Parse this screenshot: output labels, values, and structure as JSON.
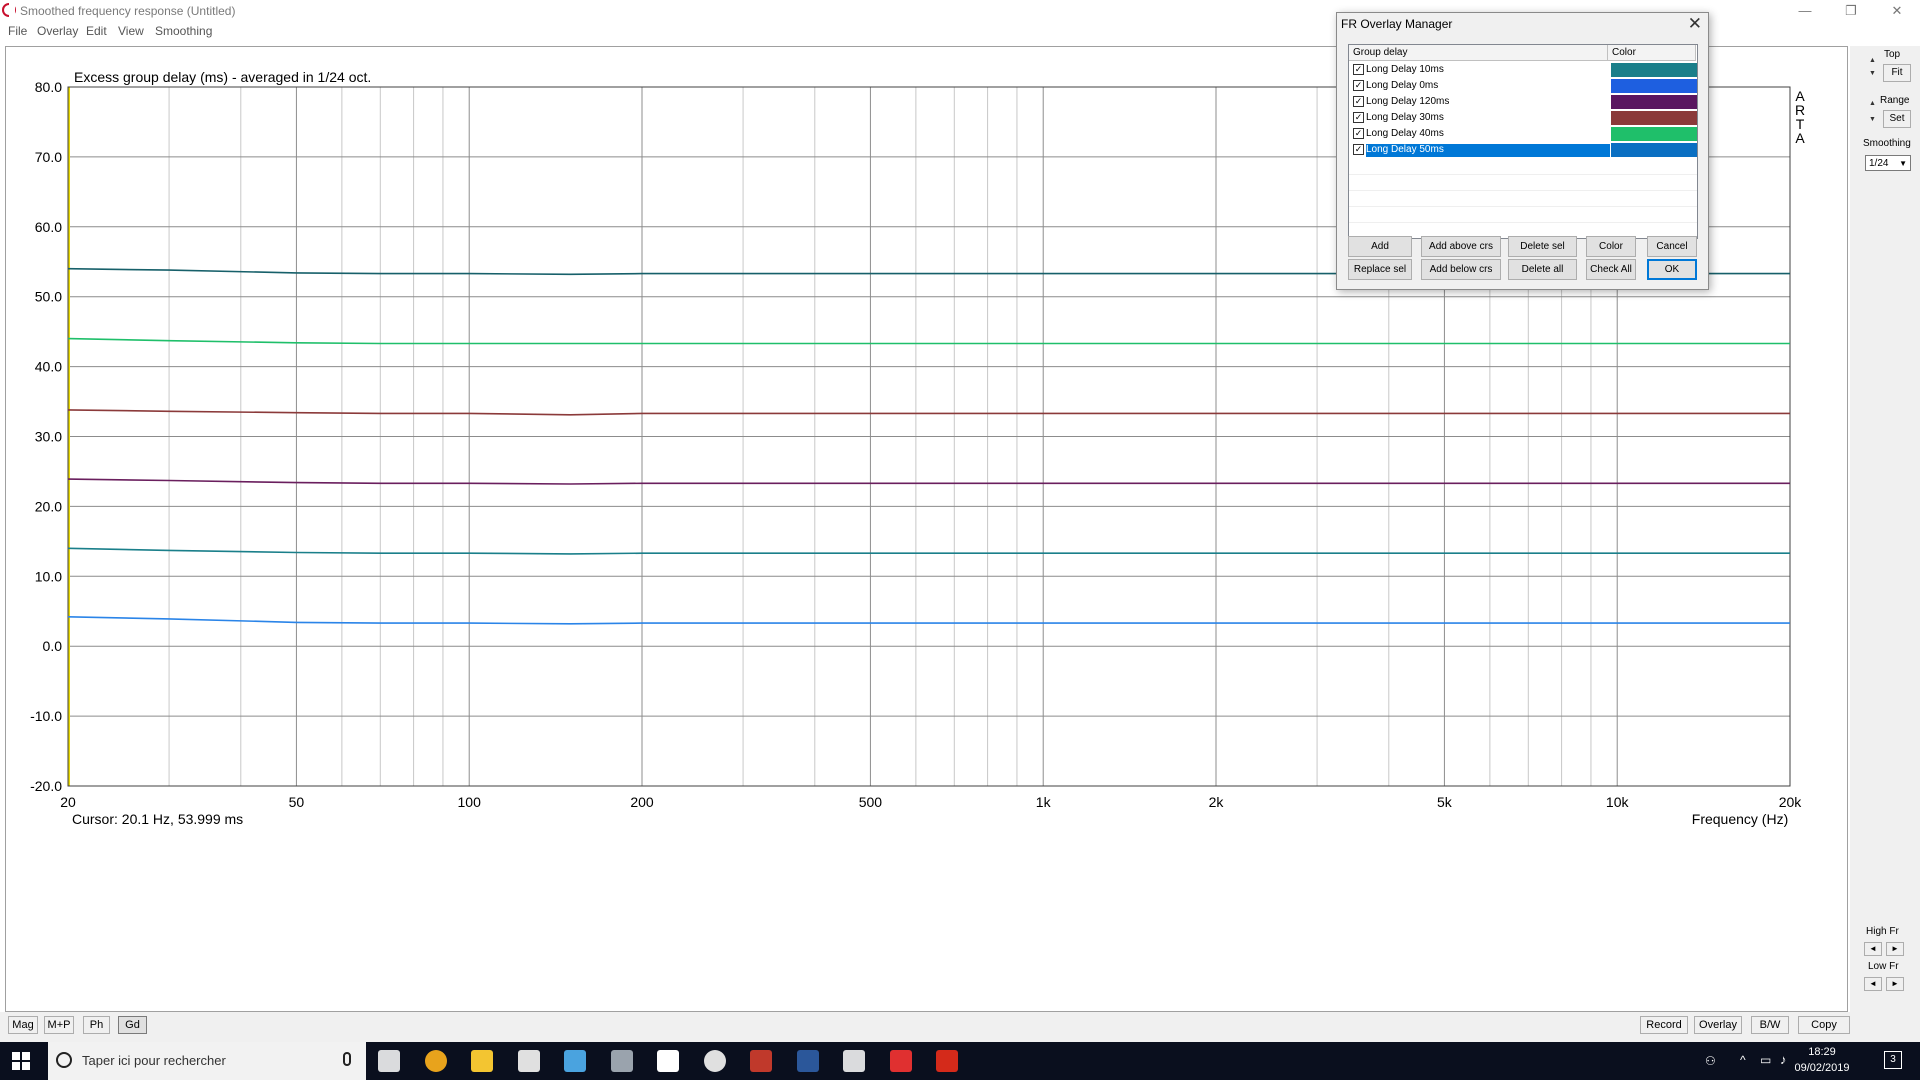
{
  "window": {
    "title": "Smoothed frequency response (Untitled)",
    "controls": [
      "—",
      "❐",
      "✕"
    ]
  },
  "menu": [
    "File",
    "Overlay",
    "Edit",
    "View",
    "Smoothing"
  ],
  "plot": {
    "caption": "Excess group delay (ms) - averaged in 1/24 oct.",
    "brand_letters": [
      "A",
      "R",
      "T",
      "A"
    ],
    "cursor": "Cursor: 20.1 Hz, 53.999 ms",
    "x_axis_label": "Frequency (Hz)"
  },
  "chart_data": {
    "type": "line",
    "title": "Excess group delay (ms) - averaged in 1/24 oct.",
    "xlabel": "Frequency (Hz)",
    "ylabel": "",
    "xscale": "log",
    "xlim": [
      20,
      20000
    ],
    "ylim": [
      -20,
      80
    ],
    "grid": true,
    "y_ticks": [
      "80.0",
      "70.0",
      "60.0",
      "50.0",
      "40.0",
      "30.0",
      "20.0",
      "10.0",
      "0.0",
      "-10.0",
      "-20.0"
    ],
    "y_tick_values": [
      80,
      70,
      60,
      50,
      40,
      30,
      20,
      10,
      0,
      -10,
      -20
    ],
    "x_ticks": [
      {
        "value": 20,
        "label": "20"
      },
      {
        "value": 50,
        "label": "50"
      },
      {
        "value": 100,
        "label": "100"
      },
      {
        "value": 200,
        "label": "200"
      },
      {
        "value": 500,
        "label": "500"
      },
      {
        "value": 1000,
        "label": "1k"
      },
      {
        "value": 2000,
        "label": "2k"
      },
      {
        "value": 5000,
        "label": "5k"
      },
      {
        "value": 10000,
        "label": "10k"
      },
      {
        "value": 20000,
        "label": "20k"
      }
    ],
    "x": [
      20,
      30,
      50,
      70,
      100,
      150,
      200,
      500,
      1000,
      5000,
      20000
    ],
    "series": [
      {
        "name": "Long Delay 10ms",
        "color": "#1a7f8a",
        "values": [
          14.0,
          13.7,
          13.4,
          13.3,
          13.3,
          13.2,
          13.3,
          13.3,
          13.3,
          13.3,
          13.3
        ]
      },
      {
        "name": "Long Delay 0ms",
        "color": "#2a84e8",
        "values": [
          4.2,
          3.9,
          3.4,
          3.3,
          3.3,
          3.2,
          3.3,
          3.3,
          3.3,
          3.3,
          3.3
        ]
      },
      {
        "name": "Long Delay 120ms",
        "color": "#6a1f5e",
        "values": [
          23.9,
          23.7,
          23.4,
          23.3,
          23.3,
          23.2,
          23.3,
          23.3,
          23.3,
          23.3,
          23.3
        ]
      },
      {
        "name": "Long Delay 30ms",
        "color": "#8b3a3a",
        "values": [
          33.8,
          33.6,
          33.4,
          33.3,
          33.3,
          33.1,
          33.3,
          33.3,
          33.3,
          33.3,
          33.3
        ]
      },
      {
        "name": "Long Delay 40ms",
        "color": "#1fbf6a",
        "values": [
          44.0,
          43.7,
          43.4,
          43.3,
          43.3,
          43.3,
          43.3,
          43.3,
          43.3,
          43.3,
          43.3
        ]
      },
      {
        "name": "Long Delay 50ms",
        "color": "#17606a",
        "values": [
          54.0,
          53.8,
          53.4,
          53.3,
          53.3,
          53.2,
          53.3,
          53.3,
          53.3,
          53.3,
          53.3
        ]
      }
    ]
  },
  "right_panel": {
    "top_label": "Top",
    "fit_label": "Fit",
    "range_label": "Range",
    "set_label": "Set",
    "smoothing_label": "Smoothing",
    "smoothing_value": "1/24",
    "high_fr_label": "High Fr",
    "low_fr_label": "Low Fr"
  },
  "bottom_left_buttons": [
    "Mag",
    "M+P",
    "Ph",
    "Gd"
  ],
  "bottom_right_buttons": [
    "Record",
    "Overlay",
    "B/W",
    "Copy"
  ],
  "dialog": {
    "title": "FR Overlay Manager",
    "close": "✕",
    "col_name": "Group delay",
    "col_color": "Color",
    "rows": [
      {
        "label": "Long Delay 10ms",
        "color": "#1a7f8a",
        "checked": "✓"
      },
      {
        "label": "Long Delay 0ms",
        "color": "#1e5fe0",
        "checked": "✓"
      },
      {
        "label": "Long Delay 120ms",
        "color": "#5a1660",
        "checked": "✓"
      },
      {
        "label": "Long Delay 30ms",
        "color": "#8b3a3a",
        "checked": "✓"
      },
      {
        "label": "Long Delay 40ms",
        "color": "#1fbf6a",
        "checked": "✓"
      },
      {
        "label": "Long Delay 50ms",
        "color": "#0a6fc2",
        "checked": "✓"
      }
    ],
    "buttons": {
      "add": "Add",
      "add_above": "Add above crs",
      "delete_sel": "Delete sel",
      "color": "Color",
      "cancel": "Cancel",
      "replace_sel": "Replace sel",
      "add_below": "Add below crs",
      "delete_all": "Delete all",
      "check_all": "Check All",
      "ok": "OK"
    }
  },
  "taskbar": {
    "search_placeholder": "Taper ici pour rechercher",
    "time": "18:29",
    "date": "09/02/2019",
    "notification_count": "3",
    "apps": [
      "task-view-icon",
      "chrome-icon",
      "file-explorer-icon",
      "calculator-icon",
      "app-icon",
      "audio-analyzer-icon",
      "store-icon",
      "media-icon",
      "steps-icon",
      "word-icon",
      "photos-icon",
      "arta-icon",
      "acrobat-icon"
    ]
  }
}
